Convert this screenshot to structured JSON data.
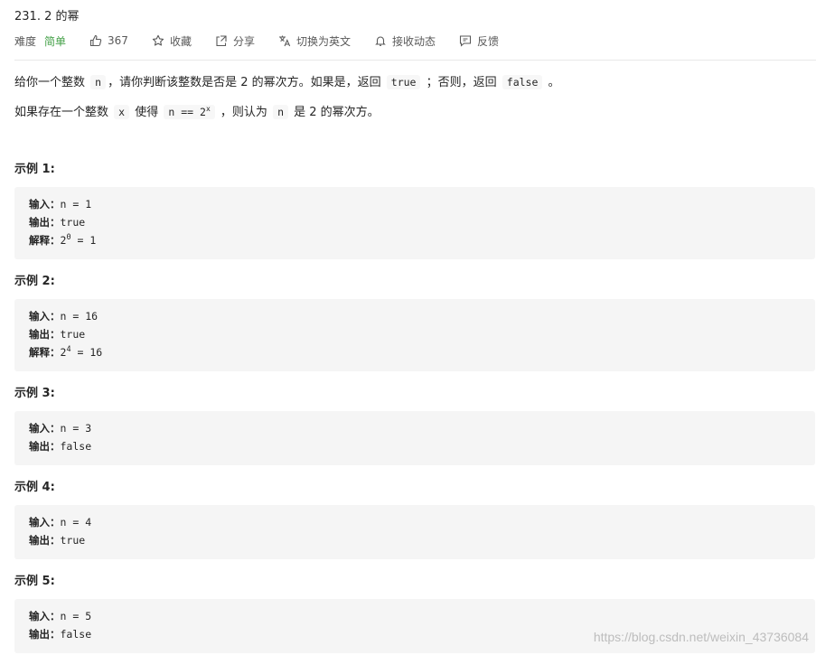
{
  "problem": {
    "title": "231. 2 的幂",
    "difficulty_label": "难度",
    "difficulty": "简单",
    "likes": "367",
    "favorite": "收藏",
    "share": "分享",
    "switch_lang": "切换为英文",
    "notifications": "接收动态",
    "feedback": "反馈"
  },
  "description": {
    "p1": {
      "t1": "给你一个整数",
      "c1": "n",
      "t2": "，请你判断该整数是否是 2 的幂次方。如果是，返回",
      "c2": "true",
      "t3": "；否则，返回",
      "c3": "false",
      "t4": "。"
    },
    "p2": {
      "t1": "如果存在一个整数",
      "c1": "x",
      "t2": "使得",
      "c2_base": "n == 2",
      "c2_sup": "x",
      "t3": "，则认为",
      "c3": "n",
      "t4": "是 2 的幂次方。"
    }
  },
  "labels": {
    "input": "输入：",
    "output": "输出：",
    "explain": "解释："
  },
  "examples": [
    {
      "title": "示例 1:",
      "input": "n = 1",
      "output": "true",
      "explain_base": "2",
      "explain_sup": "0",
      "explain_rest": " = 1"
    },
    {
      "title": "示例 2:",
      "input": "n = 16",
      "output": "true",
      "explain_base": "2",
      "explain_sup": "4",
      "explain_rest": " = 16"
    },
    {
      "title": "示例 3:",
      "input": "n = 3",
      "output": "false"
    },
    {
      "title": "示例 4:",
      "input": "n = 4",
      "output": "true"
    },
    {
      "title": "示例 5:",
      "input": "n = 5",
      "output": "false"
    }
  ],
  "watermark": "https://blog.csdn.net/weixin_43736084",
  "colors": {
    "difficulty_easy": "#43a047",
    "code_bg": "#f5f5f5"
  }
}
